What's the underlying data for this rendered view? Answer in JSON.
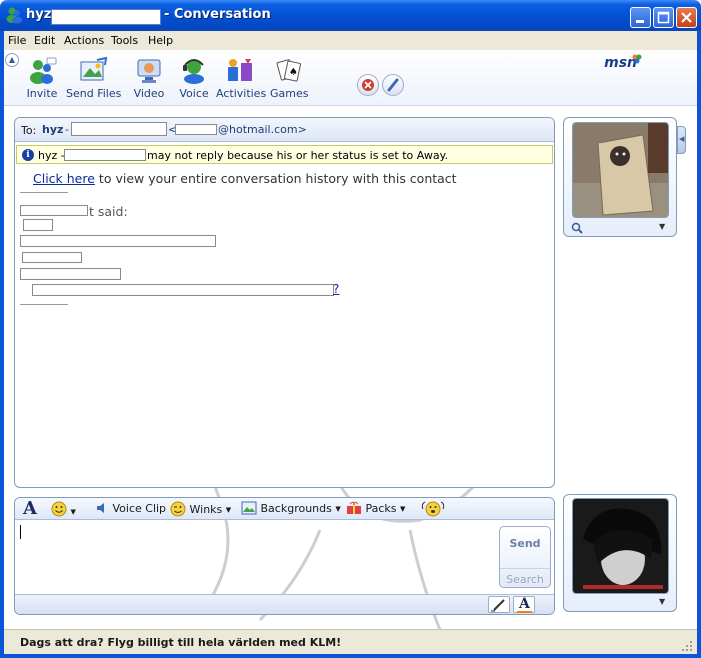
{
  "window": {
    "title_name": "hyz",
    "title_suffix": "- Conversation"
  },
  "menu": [
    "File",
    "Edit",
    "Actions",
    "Tools",
    "Help"
  ],
  "toolbar": {
    "items": [
      {
        "label": "Invite",
        "icon": "invite-icon"
      },
      {
        "label": "Send Files",
        "icon": "send-files-icon"
      },
      {
        "label": "Video",
        "icon": "video-icon"
      },
      {
        "label": "Voice",
        "icon": "voice-icon"
      },
      {
        "label": "Activities",
        "icon": "activities-icon"
      },
      {
        "label": "Games",
        "icon": "games-icon"
      }
    ],
    "logo": "msn"
  },
  "conversation": {
    "to_label": "To:",
    "to_name": "hyz",
    "to_dash": "-",
    "email_open": "<",
    "email_domain": "@hotmail.com>",
    "notice_name": "hyz -",
    "notice_text": "may not reply because his or her status is set to Away.",
    "history_link": "Click here",
    "history_text": "to view your entire conversation history with this contact",
    "said_text": "t said:",
    "link_tail": "?"
  },
  "compose": {
    "font_icon": "A",
    "voice_clip": "Voice Clip",
    "winks": "Winks",
    "backgrounds": "Backgrounds",
    "packs": "Packs",
    "send": "Send",
    "search": "Search"
  },
  "ad": {
    "text": "Dags att dra? Flyg billigt till hela världen med KLM!"
  },
  "colors": {
    "titlebar": "#0552d4",
    "frame": "#0a55d8",
    "link": "#0a2a9a",
    "notice_bg": "#ffffe1"
  }
}
